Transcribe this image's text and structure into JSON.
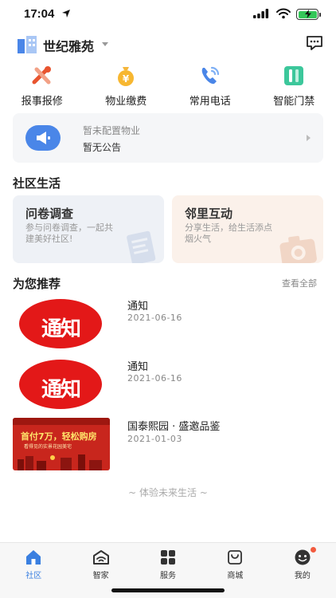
{
  "status_bar": {
    "time": "17:04"
  },
  "header": {
    "community_name": "世纪雅苑"
  },
  "quick_actions": [
    {
      "label": "报事报修",
      "icon": "wrench-repair-icon"
    },
    {
      "label": "物业缴费",
      "icon": "yen-bag-icon"
    },
    {
      "label": "常用电话",
      "icon": "phone-icon"
    },
    {
      "label": "智能门禁",
      "icon": "door-access-icon"
    }
  ],
  "notice": {
    "line1": "暂未配置物业",
    "line2": "暂无公告"
  },
  "community": {
    "title": "社区生活",
    "cards": [
      {
        "title": "问卷调查",
        "desc": "参与问卷调查，一起共建美好社区!"
      },
      {
        "title": "邻里互动",
        "desc": "分享生活，给生活添点烟火气"
      }
    ]
  },
  "recommend": {
    "title": "为您推荐",
    "more": "查看全部",
    "items": [
      {
        "title": "通知",
        "date": "2021-06-16",
        "badge": "通知"
      },
      {
        "title": "通知",
        "date": "2021-06-16",
        "badge": "通知"
      },
      {
        "title": "国泰熙园 · 盛邀品鉴",
        "date": "2021-01-03",
        "banner_main": "首付7万，轻松购房",
        "banner_sub": "看得见的实景花园美宅"
      }
    ]
  },
  "footer_tip": "~ 体验未来生活 ~",
  "tabbar": [
    {
      "label": "社区",
      "icon": "home-icon",
      "active": true
    },
    {
      "label": "智家",
      "icon": "smart-home-icon",
      "active": false
    },
    {
      "label": "服务",
      "icon": "grid-icon",
      "active": false
    },
    {
      "label": "商城",
      "icon": "shopping-bag-icon",
      "active": false
    },
    {
      "label": "我的",
      "icon": "profile-face-icon",
      "active": false
    }
  ],
  "colors": {
    "accent": "#3a7fe0",
    "badge_red": "#e31818",
    "notice_icon": "#4a86e8"
  }
}
